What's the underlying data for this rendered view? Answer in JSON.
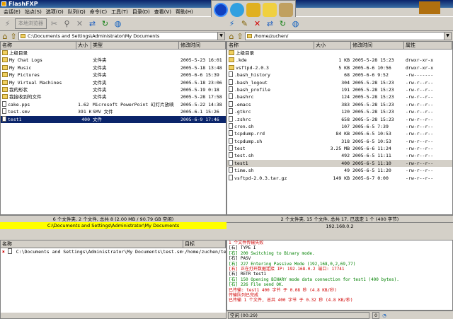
{
  "title": "FlashFXP",
  "menu": [
    "会话(E)",
    "站点(S)",
    "选项(O)",
    "队列(Q)",
    "命令(C)",
    "工具(T)",
    "目录(D)",
    "查看(V)",
    "帮助(H)"
  ],
  "left": {
    "toolbar_text": "本地浏览器",
    "path": "C:\\Documents and Settings\\Administrator\\My Documents",
    "columns": [
      "名称",
      "大小",
      "类型",
      "修改时间"
    ],
    "rows": [
      {
        "name": "上级目录",
        "size": "",
        "type": "",
        "mtime": "",
        "icon": "up"
      },
      {
        "name": "My Chat Logs",
        "size": "",
        "type": "文件夹",
        "mtime": "2005-5-23 16:01",
        "icon": "folder"
      },
      {
        "name": "My Music",
        "size": "",
        "type": "文件夹",
        "mtime": "2005-5-18 13:48",
        "icon": "folder"
      },
      {
        "name": "My Pictures",
        "size": "",
        "type": "文件夹",
        "mtime": "2005-6-6 15:39",
        "icon": "folder"
      },
      {
        "name": "My Virtual Machines",
        "size": "",
        "type": "文件夹",
        "mtime": "2005-5-18 23:06",
        "icon": "folder"
      },
      {
        "name": "我的形状",
        "size": "",
        "type": "文件夹",
        "mtime": "2005-5-19 0:18",
        "icon": "folder"
      },
      {
        "name": "我接收到的文件",
        "size": "",
        "type": "文件夹",
        "mtime": "2005-5-28 17:58",
        "icon": "folder"
      },
      {
        "name": "cake.pps",
        "size": "1.62 MB",
        "type": "Microsoft PowerPoint 幻灯片放映",
        "mtime": "2005-5-22 14:38",
        "icon": "file"
      },
      {
        "name": "test.smv",
        "size": "391 KB",
        "type": "SMV 文件",
        "mtime": "2005-6-1 15:26",
        "icon": "file"
      },
      {
        "name": "test1",
        "size": "400",
        "type": "文件",
        "mtime": "2005-6-9 17:46",
        "icon": "file",
        "selected": true
      }
    ],
    "status": "6 个文件夹, 2 个文件, 总共 8 (2.00 MB / 90.79 GB 空闲)",
    "status_path": "C:\\Documents and Settings\\Administrator\\My Documents"
  },
  "right": {
    "path": "/home/zuchen/",
    "columns": [
      "名称",
      "大小",
      "修改时间",
      "属性"
    ],
    "rows": [
      {
        "name": "上级目录",
        "size": "",
        "mtime": "",
        "attr": "",
        "icon": "up"
      },
      {
        "name": ".kde",
        "size": "1 KB",
        "mtime": "2005-5-28 15:23",
        "attr": "drwxr-xr-x",
        "icon": "folder"
      },
      {
        "name": "vsftpd-2.0.3",
        "size": "5 KB",
        "mtime": "2005-6-6 10:56",
        "attr": "drwxr-xr-x",
        "icon": "folder"
      },
      {
        "name": ".bash_history",
        "size": "68",
        "mtime": "2005-6-6 9:52",
        "attr": "-rw-------",
        "icon": "file"
      },
      {
        "name": ".bash_logout",
        "size": "304",
        "mtime": "2005-5-28 15:23",
        "attr": "-rw-r--r--",
        "icon": "file"
      },
      {
        "name": ".bash_profile",
        "size": "191",
        "mtime": "2005-5-28 15:23",
        "attr": "-rw-r--r--",
        "icon": "file"
      },
      {
        "name": ".bashrc",
        "size": "124",
        "mtime": "2005-5-28 15:23",
        "attr": "-rw-r--r--",
        "icon": "file"
      },
      {
        "name": ".emacs",
        "size": "383",
        "mtime": "2005-5-28 15:23",
        "attr": "-rw-r--r--",
        "icon": "file"
      },
      {
        "name": ".gtkrc",
        "size": "120",
        "mtime": "2005-5-28 15:23",
        "attr": "-rw-r--r--",
        "icon": "file"
      },
      {
        "name": ".zshrc",
        "size": "658",
        "mtime": "2005-5-28 15:23",
        "attr": "-rw-r--r--",
        "icon": "file"
      },
      {
        "name": "cron.sh",
        "size": "107",
        "mtime": "2005-6-5 7:39",
        "attr": "-rw-r--r--",
        "icon": "file"
      },
      {
        "name": "tcpdump.rrd",
        "size": "84 KB",
        "mtime": "2005-6-5 10:53",
        "attr": "-rw-r--r--",
        "icon": "file"
      },
      {
        "name": "tcpdump.sh",
        "size": "318",
        "mtime": "2005-6-5 10:53",
        "attr": "-rw-r--r--",
        "icon": "file"
      },
      {
        "name": "test",
        "size": "3.25 MB",
        "mtime": "2005-6-6 11:24",
        "attr": "-rw-r--r--",
        "icon": "file"
      },
      {
        "name": "test.sh",
        "size": "492",
        "mtime": "2005-6-5 11:11",
        "attr": "-rw-r--r--",
        "icon": "file"
      },
      {
        "name": "test1",
        "size": "400",
        "mtime": "2005-6-5 11:10",
        "attr": "-rw-r--r--",
        "icon": "file",
        "gray": true
      },
      {
        "name": "time.sh",
        "size": "49",
        "mtime": "2005-6-5 11:20",
        "attr": "-rw-r--r--",
        "icon": "file"
      },
      {
        "name": "vsftpd-2.0.3.tar.gz",
        "size": "149 KB",
        "mtime": "2005-6-7 0:00",
        "attr": "-rw-r--r--",
        "icon": "file"
      }
    ],
    "status": "2 个文件夹, 15 个文件, 总共 17, 已选定 1 个 (400 字节)",
    "status_host": "192.168.0.2"
  },
  "queue": {
    "columns": [
      "名称",
      "目标"
    ],
    "item_source": "C:\\Documents and Settings\\Administrator\\My Documents\\test.smv",
    "item_target": "/home/zuchen/te"
  },
  "log": [
    {
      "c": "red",
      "t": "1 个文件传输失败"
    },
    {
      "c": "blk",
      "t": "[右] TYPE I"
    },
    {
      "c": "grn",
      "t": "[右] 200 Switching to Binary mode."
    },
    {
      "c": "blk",
      "t": "[右] PASV"
    },
    {
      "c": "grn",
      "t": "[右] 227 Entering Passive Mode (192,168,0,2,69,77)"
    },
    {
      "c": "red",
      "t": "[右] 正在打开数据连接 IP: 192.168.0.2 端口: 17741"
    },
    {
      "c": "blk",
      "t": "[右] RETR test1"
    },
    {
      "c": "grn",
      "t": "[右] 150 Opening BINARY mode data connection for test1 (400 bytes)."
    },
    {
      "c": "grn",
      "t": "[右] 226 File send OK."
    },
    {
      "c": "red",
      "t": "已传输: test1 400 字节 于 0.08 秒 (4.8 KB/秒)"
    },
    {
      "c": "red",
      "t": "传输队列已完成"
    },
    {
      "c": "red",
      "t": "已传输 1 个文件, 总共 400 字节 于 0.32 秒 (4.8 KB/秒)"
    }
  ],
  "bottom": {
    "idle": "空闲 (00:29)",
    "num": "0"
  }
}
